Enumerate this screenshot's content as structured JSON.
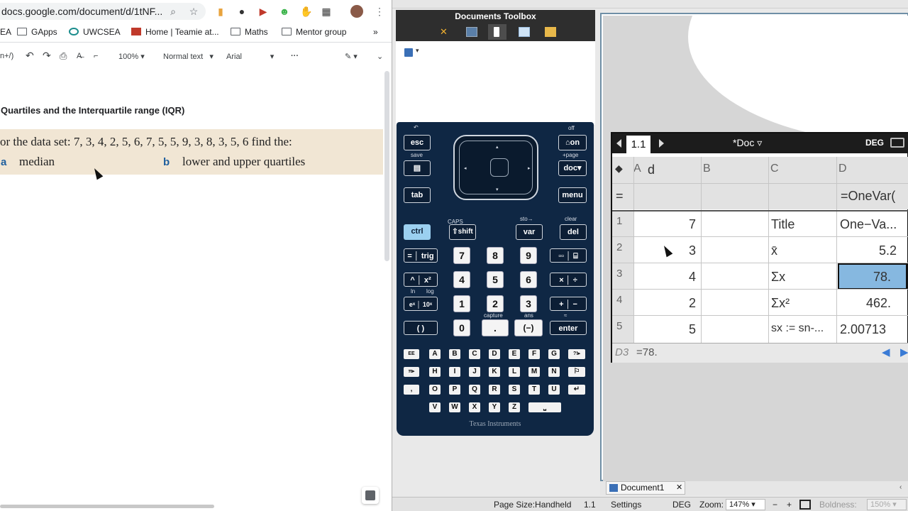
{
  "browser": {
    "url": "docs.google.com/document/d/1tNF...",
    "bookmarks": [
      "EA",
      "GApps",
      "UWCSEA",
      "Home | Teamie at...",
      "Maths",
      "Mentor group"
    ],
    "more": "»"
  },
  "doc_toolbar": {
    "shortcut": "n+/)",
    "zoom": "100%",
    "style": "Normal text",
    "font": "Arial",
    "more": "···"
  },
  "doc": {
    "heading": "Quartiles and the Interquartile range (IQR)",
    "problem": "or the data set:    7, 3, 4, 2, 5, 6, 7, 5, 5, 9, 3, 8, 3, 5, 6    find the:",
    "part_a_label": "a",
    "part_a_text": "median",
    "part_b_label": "b",
    "part_b_text": "lower and upper quartiles"
  },
  "toolbox": {
    "title": "Documents Toolbox"
  },
  "calculator": {
    "top_labels": {
      "esc_above": "↶",
      "off": "off",
      "save": "save",
      "page": "+page",
      "capture_lbl": "capture",
      "ans": "ans",
      "approx": "≈",
      "caps": "CAPS",
      "sto": "sto→",
      "clear": "clear",
      "ln": "ln",
      "log": "log"
    },
    "keys": {
      "esc": "esc",
      "on": "⌂on",
      "scratch": "▤",
      "doc": "doc▾",
      "tab": "tab",
      "menu": "menu",
      "ctrl": "ctrl",
      "shift": "⇧shift",
      "var": "var",
      "del": "del",
      "eq": "=",
      "trig": "trig",
      "pow": "^",
      "sq": "x²",
      "ex": "eˣ",
      "tenx": "10ˣ",
      "paren": "(   )",
      "n7": "7",
      "n8": "8",
      "n9": "9",
      "n4": "4",
      "n5": "5",
      "n6": "6",
      "n1": "1",
      "n2": "2",
      "n3": "3",
      "n0": "0",
      "dot": ".",
      "neg": "(−)",
      "frac": "▫▫",
      "book": "⌸",
      "mul": "×",
      "div": "÷",
      "add": "+",
      "sub": "−",
      "enter": "enter"
    },
    "letters_row1": [
      "EE",
      "A",
      "B",
      "C",
      "D",
      "E",
      "F",
      "G",
      "?!▸"
    ],
    "letters_row2": [
      "π▸",
      "H",
      "I",
      "J",
      "K",
      "L",
      "M",
      "N",
      "⚐"
    ],
    "letters_row3": [
      ",",
      "O",
      "P",
      "Q",
      "R",
      "S",
      "T",
      "U",
      "↵"
    ],
    "letters_row4": [
      "V",
      "W",
      "X",
      "Y",
      "Z",
      "⎵"
    ],
    "brand": "Texas Instruments"
  },
  "spreadsheet": {
    "page_tab": "1.1",
    "doc_name": "*Doc",
    "mode": "DEG",
    "columns": [
      "A",
      "B",
      "C",
      "D"
    ],
    "col_a_name": "d",
    "formula_row_d": "=OneVar(",
    "rows": [
      {
        "n": "1",
        "a": "7",
        "c": "Title",
        "d": "One−Va..."
      },
      {
        "n": "2",
        "a": "3",
        "c": "x̄",
        "d": "5.2"
      },
      {
        "n": "3",
        "a": "4",
        "c": "Σx",
        "d": "78."
      },
      {
        "n": "4",
        "a": "2",
        "c": "Σx²",
        "d": "462."
      },
      {
        "n": "5",
        "a": "5",
        "c": "sx := sn-...",
        "d": "2.00713"
      }
    ],
    "eq_symbol": "=",
    "selected_cell": "D3",
    "entry_value": "=78."
  },
  "tabs": {
    "document": "Document1",
    "close": "✕"
  },
  "status": {
    "page_size": "Page Size:Handheld",
    "page": "1.1",
    "settings": "Settings",
    "mode": "DEG",
    "zoom_label": "Zoom:",
    "zoom": "147%",
    "boldness_label": "Boldness:",
    "boldness": "150%"
  },
  "colors": {
    "problem_bg": "#f1e6d4",
    "label_blue": "#1f5f9e",
    "calc_body": "#0f2744",
    "selected_cell": "#86b8e0"
  }
}
